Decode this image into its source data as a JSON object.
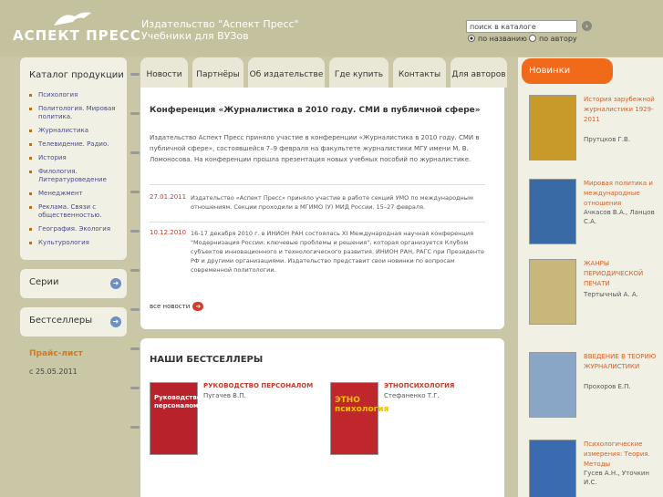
{
  "header": {
    "logo": "АСПЕКТ ПРЕСС",
    "tagline_line1": "Издательство \"Аспект Пресс\"",
    "tagline_line2": "Учебники для ВУЗов",
    "search_placeholder": "поиск в каталоге",
    "radio_name": "по названию",
    "radio_author": "по автору"
  },
  "sidebar": {
    "catalog_title": "Каталог продукции",
    "items": [
      "Психология",
      "Политология. Мировая политика.",
      "Журналистика",
      "Телевидение. Радио.",
      "История",
      "Филология. Литературоведение",
      "Менеджмент",
      "Реклама. Связи с общественностью.",
      "География. Экология",
      "Культурология"
    ],
    "series": "Серии",
    "bestsellers": "Бестселлеры",
    "price_list": "Прайс-лист",
    "price_date": "с 25.05.2011"
  },
  "tabs": [
    "Новости",
    "Партнёры",
    "Об издательстве",
    "Где купить",
    "Контакты",
    "Для авторов"
  ],
  "new_tab": "Новинки",
  "news": {
    "title": "Конференция «Журналистика в 2010 году. СМИ в публичной сфере»",
    "body": "Издательство Аспект Пресс приняло участие в конференции «Журналистика в 2010 году. СМИ в публичной сфере», состоявшейся 7–9 февраля на факультете журналистики МГУ имени М. В. Ломоносова. На конференции прошла презентация новых учебных пособий по журналистике.",
    "items": [
      {
        "date": "27.01.2011",
        "text": "Издательство «Аспект Пресс» приняло участие в работе секций УМО по международным отношениям. Секции проходили в МГИМО (У) МИД России. 15–27 февраля."
      },
      {
        "date": "10.12.2010",
        "text": "16-17 декабря 2010 г. в ИНИОН РАН состоялась XI Международная научная конференция \"Модернизация России: ключевые проблемы и решения\", которая организуется Клубом субъектов инновационного и технологического развития. ИНИОН РАН, РАГС при Президенте РФ и другими организациями. Издательство представит свои новинки по вопросам современной политологии."
      }
    ],
    "all_news": "все новости"
  },
  "bestsellers": {
    "title": "НАШИ БЕСТСЕЛЛЕРЫ",
    "books": [
      {
        "title": "РУКОВОДСТВО ПЕРСОНАЛОМ",
        "author": "Пугачев В.П.",
        "cover_text": "Руководство персоналом",
        "cover_color": "#b8232b"
      },
      {
        "title": "ЭТНОПСИХОЛОГИЯ",
        "author": "Стефаненко Т.Г.",
        "cover_text": "ЭТНО психология",
        "cover_color": "#c0272d"
      }
    ]
  },
  "new_books": [
    {
      "title": "История зарубежной журналистики 1929-2011",
      "author": "Прутцков Г.В.",
      "cover_color": "#c79a2a"
    },
    {
      "title": "Мировая политика и международные отношения",
      "author": "Ачкасов В.А., Ланцов С.А.",
      "cover_color": "#3a6aa6"
    },
    {
      "title": "ЖАНРЫ ПЕРИОДИЧЕСКОЙ ПЕЧАТИ",
      "author": "Тертычный А. А.",
      "cover_color": "#c8b77a"
    },
    {
      "title": "ВВЕДЕНИЕ В ТЕОРИЮ ЖУРНАЛИСТИКИ",
      "author": "Прохоров Е.П.",
      "cover_color": "#8aa6c6"
    },
    {
      "title": "Психологические измерения: Теория. Методы",
      "author": "Гусев А.Н., Уточкин И.С.",
      "cover_color": "#3a6ab0"
    }
  ]
}
